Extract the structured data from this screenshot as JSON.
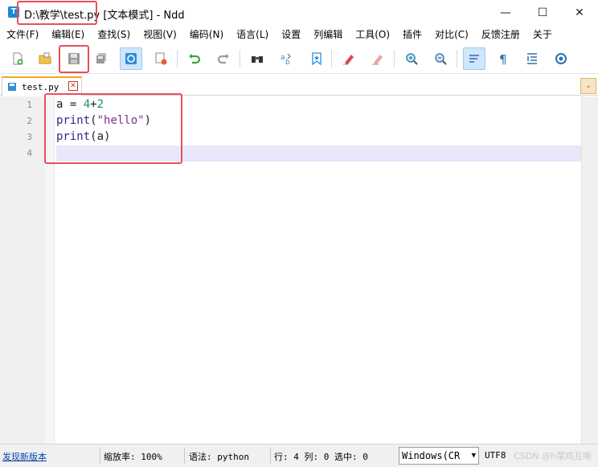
{
  "window": {
    "title_path": "D:\\教学\\test.py",
    "title_rest": " [文本模式] - Ndd",
    "icon_letter": "T",
    "minimize": "—",
    "maximize": "☐",
    "close": "✕"
  },
  "menu": [
    "文件(F)",
    "编辑(E)",
    "查找(S)",
    "视图(V)",
    "编码(N)",
    "语言(L)",
    "设置",
    "列编辑",
    "工具(O)",
    "插件",
    "对比(C)",
    "反馈注册",
    "关于"
  ],
  "toolbar": {
    "icons": [
      "new-file-icon",
      "open-file-icon",
      "save-icon",
      "save-all-icon",
      "close-file-icon",
      "close-all-icon",
      "undo-icon",
      "redo-icon",
      "find-icon",
      "replace-icon",
      "bookmark-icon",
      "mark-icon",
      "clear-mark-icon",
      "zoom-in-icon",
      "zoom-out-icon",
      "wrap-icon",
      "show-symbols-icon",
      "indent-guide-icon",
      "settings-icon"
    ]
  },
  "tab": {
    "label": "test.py",
    "close": "✕",
    "dropdown": "⌄"
  },
  "editor": {
    "line_numbers": [
      "1",
      "2",
      "3",
      "4"
    ],
    "code": {
      "line1": {
        "a": "a",
        "eq": " = ",
        "n1": "4",
        "plus": "+",
        "n2": "2"
      },
      "line2": {
        "fn": "print",
        "open": "(",
        "str": "\"hello\"",
        "close": ")"
      },
      "line3": {
        "fn": "print",
        "rest": "(a)"
      }
    }
  },
  "status": {
    "update_link": "发现新版本",
    "zoom": "缩放率: 100%",
    "syntax": "语法: python",
    "position": "行: 4 列: 0 选中: 0",
    "line_ending": "Windows(CR",
    "encoding": "UTF8",
    "watermark": "CSDN @h菜鸡互啄"
  },
  "colors": {
    "keyword": "#2b2b8c",
    "number": "#1c8a77",
    "string": "#7c2f8f",
    "highlight_box": "#e8505b",
    "current_line": "#e8e8fa"
  }
}
